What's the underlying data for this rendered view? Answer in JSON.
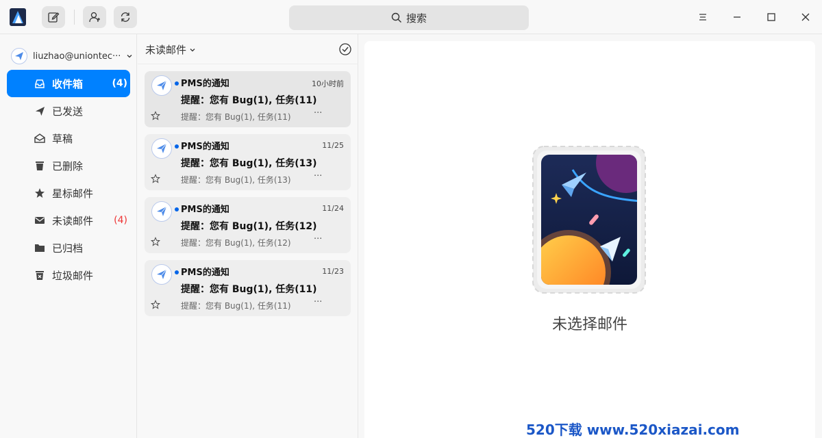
{
  "titlebar": {
    "search_label": "搜索",
    "buttons": [
      "compose-icon",
      "contacts-icon",
      "refresh-icon"
    ],
    "window_controls": [
      "menu-icon",
      "minimize-icon",
      "maximize-icon",
      "close-icon"
    ]
  },
  "sidebar": {
    "account": "liuzhao@uniontec···",
    "items": [
      {
        "label": "收件箱",
        "count": "(4)",
        "icon": "inbox-icon"
      },
      {
        "label": "已发送",
        "count": "",
        "icon": "send-icon"
      },
      {
        "label": "草稿",
        "count": "",
        "icon": "draft-icon"
      },
      {
        "label": "已删除",
        "count": "",
        "icon": "trash-icon"
      },
      {
        "label": "星标邮件",
        "count": "",
        "icon": "star-icon"
      },
      {
        "label": "未读邮件",
        "count": "(4)",
        "icon": "unread-icon"
      },
      {
        "label": "已归档",
        "count": "",
        "icon": "folder-icon"
      },
      {
        "label": "垃圾邮件",
        "count": "",
        "icon": "junk-icon"
      }
    ]
  },
  "mail_list": {
    "filter_label": "未读邮件",
    "mails": [
      {
        "sender": "PMS的通知",
        "date": "10小时前",
        "subject": "提醒：您有 Bug(1), 任务(11)",
        "preview": "提醒：您有 Bug(1), 任务(11)",
        "more": "···"
      },
      {
        "sender": "PMS的通知",
        "date": "11/25",
        "subject": "提醒：您有 Bug(1), 任务(13)",
        "preview": "提醒：您有 Bug(1), 任务(13)",
        "more": "···"
      },
      {
        "sender": "PMS的通知",
        "date": "11/24",
        "subject": "提醒：您有 Bug(1), 任务(12)",
        "preview": "提醒：您有 Bug(1), 任务(12)",
        "more": "···"
      },
      {
        "sender": "PMS的通知",
        "date": "11/23",
        "subject": "提醒：您有 Bug(1), 任务(11)",
        "preview": "提醒：您有 Bug(1), 任务(11)",
        "more": "···"
      }
    ]
  },
  "content": {
    "empty_text": "未选择邮件"
  },
  "watermark": "520下载 www.520xiazai.com",
  "colors": {
    "accent": "#0081ff",
    "unread_count": "#e33333",
    "dot": "#0064e8"
  }
}
